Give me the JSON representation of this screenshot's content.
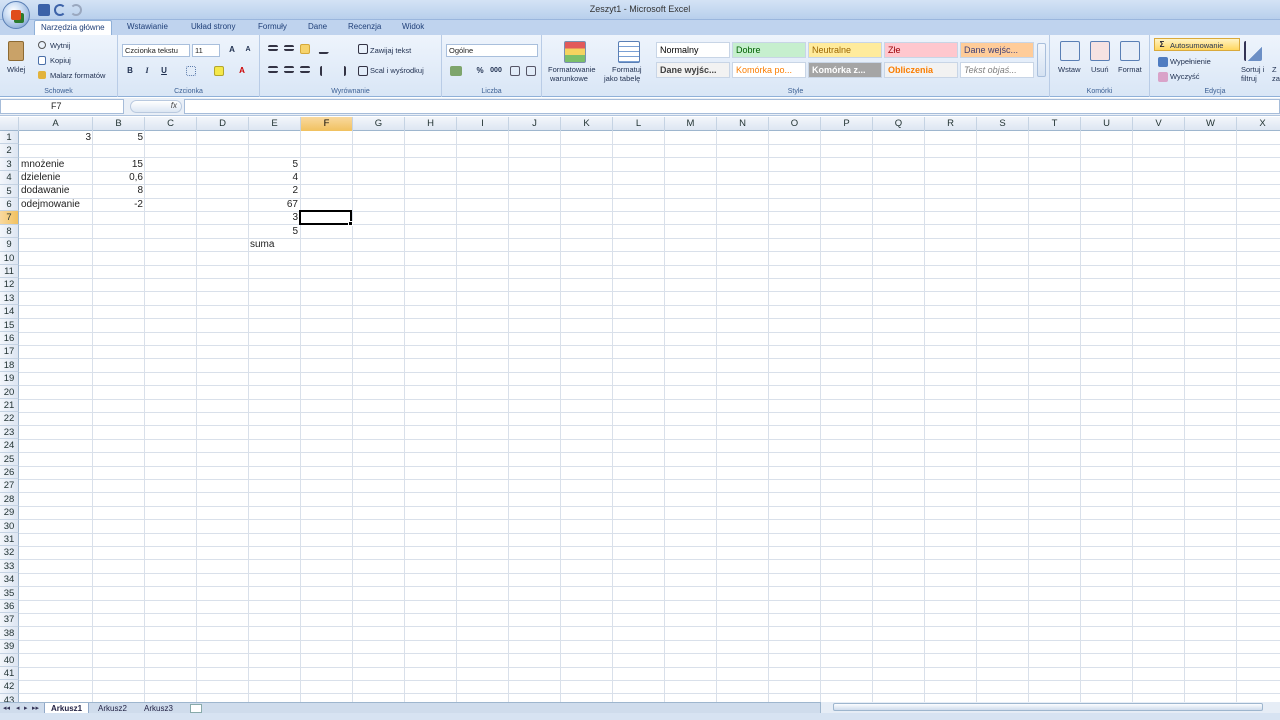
{
  "window": {
    "title": "Zeszyt1 - Microsoft Excel"
  },
  "tabs": [
    "Narzędzia główne",
    "Wstawianie",
    "Układ strony",
    "Formuły",
    "Dane",
    "Recenzja",
    "Widok"
  ],
  "ribbon": {
    "clipboard": {
      "paste": "Wklej",
      "cut": "Wytnij",
      "copy": "Kopiuj",
      "painter": "Malarz formatów",
      "label": "Schowek"
    },
    "font": {
      "name": "Czcionka tekstu",
      "size": "11",
      "bold": "B",
      "italic": "I",
      "underline": "U",
      "label": "Czcionka"
    },
    "align": {
      "wrap": "Zawijaj tekst",
      "merge": "Scal i wyśrodkuj",
      "label": "Wyrównanie"
    },
    "number": {
      "format": "Ogólne",
      "percent": "%",
      "thousands": "000",
      "label": "Liczba"
    },
    "styles": {
      "cond_line1": "Formatowanie",
      "cond_line2": "warunkowe",
      "table_line1": "Formatuj",
      "table_line2": "jako tabelę",
      "label": "Style",
      "items": [
        {
          "text": "Normalny",
          "color": "#000000",
          "bg": "#ffffff"
        },
        {
          "text": "Dobre",
          "color": "#006100",
          "bg": "#c6efce"
        },
        {
          "text": "Neutralne",
          "color": "#9c6500",
          "bg": "#ffeb9c"
        },
        {
          "text": "Złe",
          "color": "#9c0006",
          "bg": "#ffc7ce"
        },
        {
          "text": "Dane wejśc...",
          "color": "#3f3f76",
          "bg": "#ffcc99"
        },
        {
          "text": "Dane wyjśc...",
          "color": "#3f3f3f",
          "bg": "#f2f2f2"
        },
        {
          "text": "Komórka po...",
          "color": "#fa7d00",
          "bg": "#ffffff"
        },
        {
          "text": "Komórka z...",
          "color": "#ffffff",
          "bg": "#a5a5a5"
        },
        {
          "text": "Obliczenia",
          "color": "#fa7d00",
          "bg": "#f2f2f2"
        },
        {
          "text": "Tekst objaś...",
          "color": "#7f7f7f",
          "bg": "#ffffff"
        }
      ]
    },
    "cells": {
      "insert": "Wstaw",
      "delete": "Usuń",
      "format": "Format",
      "label": "Komórki"
    },
    "edit": {
      "autosum": "Autosumowanie",
      "fill": "Wypełnienie",
      "clear": "Wyczyść",
      "sort_line1": "Sortuj i",
      "sort_line2": "filtruj",
      "find_line1": "Z",
      "find_line2": "za",
      "label": "Edycja"
    }
  },
  "formula": {
    "namebox": "F7",
    "fx": "fx",
    "content": ""
  },
  "columns": [
    "A",
    "B",
    "C",
    "D",
    "E",
    "F",
    "G",
    "H",
    "I",
    "J",
    "K",
    "L",
    "M",
    "N",
    "O",
    "P",
    "Q",
    "R",
    "S",
    "T",
    "U",
    "V",
    "W",
    "X"
  ],
  "rows": [
    "1",
    "2",
    "3",
    "4",
    "5",
    "6",
    "7",
    "8",
    "9",
    "10",
    "11",
    "12",
    "13",
    "14",
    "15",
    "16",
    "17",
    "18",
    "19",
    "20",
    "21",
    "22",
    "23",
    "24",
    "25",
    "26",
    "27",
    "28",
    "29",
    "30",
    "31",
    "32",
    "33",
    "34",
    "35",
    "36",
    "37",
    "38",
    "39",
    "40",
    "41",
    "42",
    "43"
  ],
  "cells": {
    "A1": "3",
    "B1": "5",
    "A3": "mnożenie",
    "B3": "15",
    "A4": "dzielenie",
    "B4": "0,6",
    "A5": "dodawanie",
    "B5": "8",
    "A6": "odejmowanie",
    "B6": "-2",
    "E3": "5",
    "E4": "4",
    "E5": "2",
    "E6": "67",
    "E7": "3",
    "E8": "5",
    "E9": "suma"
  },
  "active_cell": "F7",
  "sheets": [
    "Arkusz1",
    "Arkusz2",
    "Arkusz3"
  ]
}
